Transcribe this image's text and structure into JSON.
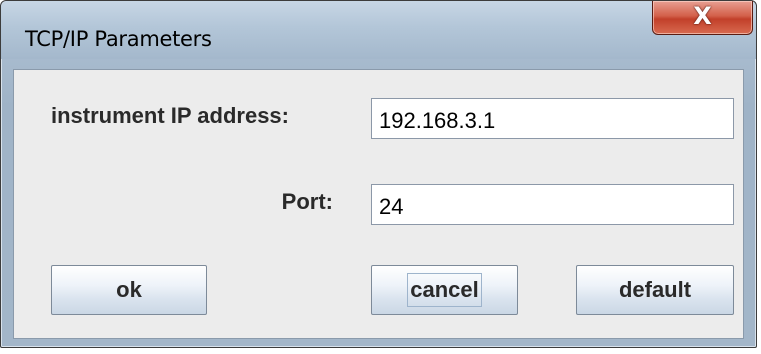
{
  "window": {
    "title": "TCP/IP Parameters",
    "close_symbol": "X"
  },
  "form": {
    "ip_label": "instrument IP address:",
    "ip_value": "192.168.3.1",
    "port_label": "Port:",
    "port_value": "24"
  },
  "buttons": {
    "ok": "ok",
    "cancel": "cancel",
    "default": "default"
  }
}
